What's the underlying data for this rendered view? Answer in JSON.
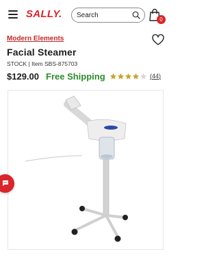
{
  "header": {
    "logo_text": "SALLY.",
    "search_placeholder": "Search",
    "cart_count": "0"
  },
  "product": {
    "brand": "Modern Elements",
    "title": "Facial Steamer",
    "stock": "STOCK",
    "item_label": "Item",
    "item_number": "SBS-875703",
    "price": "$129.00",
    "shipping": "Free Shipping",
    "rating": 4.0,
    "rating_max": 5,
    "review_count": "44"
  },
  "colors": {
    "accent": "#d9252b",
    "shipping_green": "#2e8b2e",
    "star_gold": "#c9a227"
  },
  "icons": {
    "menu": "hamburger-icon",
    "search": "search-icon",
    "cart": "shopping-bag-icon",
    "wishlist": "heart-icon",
    "chat": "chat-icon"
  }
}
